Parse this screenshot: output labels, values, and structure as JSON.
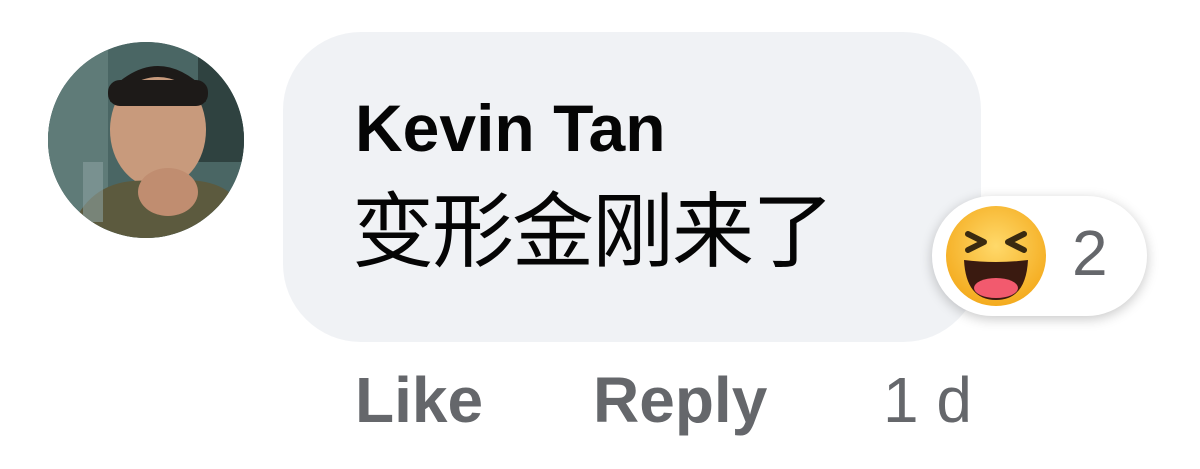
{
  "comment": {
    "author": "Kevin Tan",
    "text": "变形金刚来了",
    "reaction": {
      "icon": "haha-emoji-icon",
      "count": "2",
      "color": "#f7b125"
    },
    "actions": {
      "like_label": "Like",
      "reply_label": "Reply",
      "timestamp": "1 d"
    }
  },
  "colors": {
    "bubble_bg": "#f0f2f5",
    "text": "#050505",
    "secondary_text": "#65676b"
  }
}
